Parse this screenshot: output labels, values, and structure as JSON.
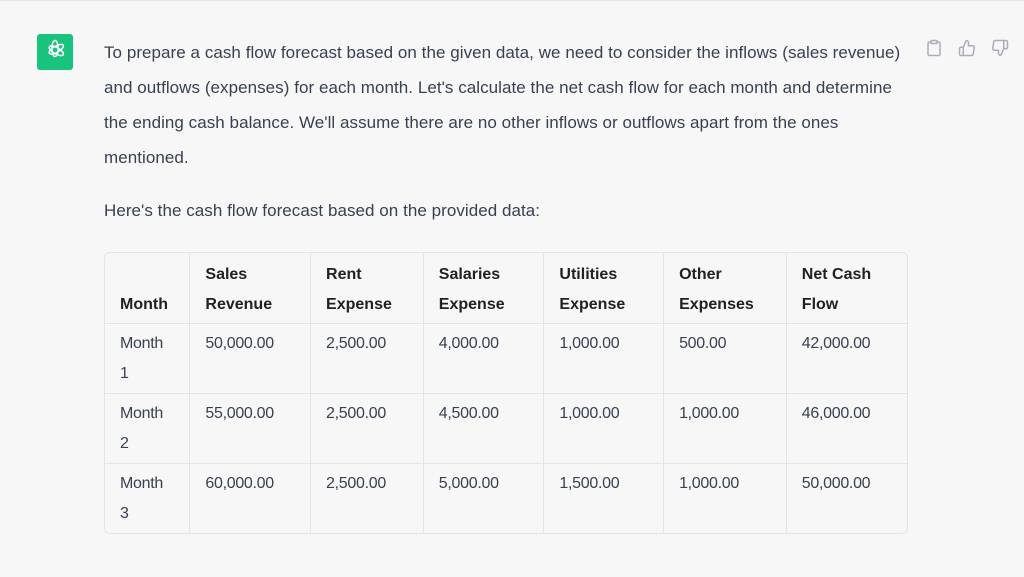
{
  "assistant": {
    "avatar_icon": "openai-logo-icon",
    "brand_color": "#19c37d"
  },
  "actions": [
    {
      "name": "copy",
      "icon": "clipboard-icon"
    },
    {
      "name": "thumbs-up",
      "icon": "thumbs-up-icon"
    },
    {
      "name": "thumbs-down",
      "icon": "thumbs-down-icon"
    }
  ],
  "message": {
    "paragraphs": [
      "To prepare a cash flow forecast based on the given data, we need to consider the inflows (sales revenue) and outflows (expenses) for each month. Let's calculate the net cash flow for each month and determine the ending cash balance. We'll assume there are no other inflows or outflows apart from the ones mentioned.",
      "Here's the cash flow forecast based on the provided data:"
    ],
    "table": {
      "headers": [
        "Month",
        "Sales Revenue",
        "Rent Expense",
        "Salaries Expense",
        "Utilities Expense",
        "Other Expenses",
        "Net Cash Flow"
      ],
      "rows": [
        [
          "Month 1",
          "50,000.00",
          "2,500.00",
          "4,000.00",
          "1,000.00",
          "500.00",
          "42,000.00"
        ],
        [
          "Month 2",
          "55,000.00",
          "2,500.00",
          "4,500.00",
          "1,000.00",
          "1,000.00",
          "46,000.00"
        ],
        [
          "Month 3",
          "60,000.00",
          "2,500.00",
          "5,000.00",
          "1,500.00",
          "1,000.00",
          "50,000.00"
        ]
      ]
    }
  }
}
